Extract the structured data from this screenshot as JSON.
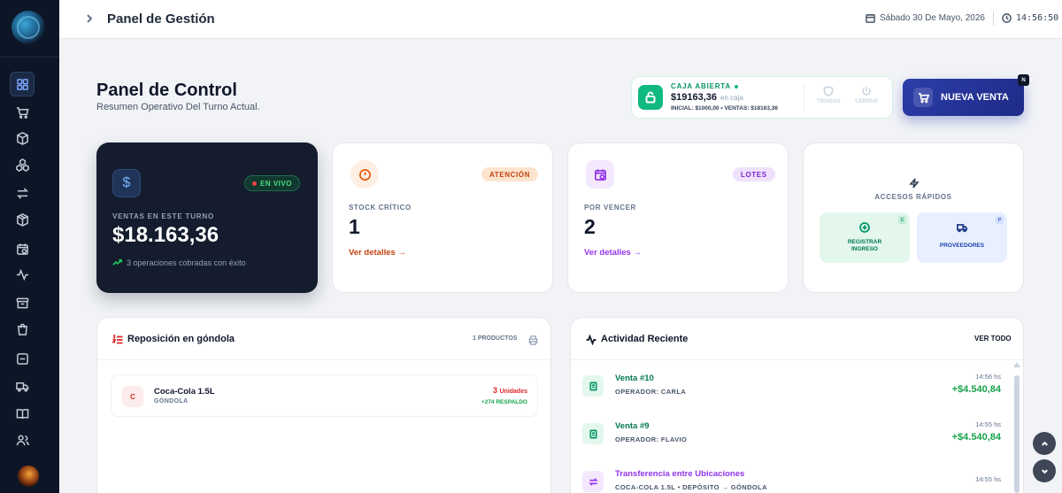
{
  "topbar": {
    "title": "Panel de Gestión",
    "date": "Sábado 30 De Mayo, 2026",
    "time": "14:56:50"
  },
  "header": {
    "title": "Panel de Control",
    "subtitle": "Resumen Operativo Del Turno Actual."
  },
  "caja": {
    "status": "CAJA ABIERTA",
    "amount": "$19163,36",
    "amount_suffix": "en caja",
    "detail": "INICIAL: $1000,00 • VENTAS: $18163,36",
    "action_1": "TIRADAS",
    "action_2": "CERRAR"
  },
  "new_sale": {
    "label": "NUEVA VENTA",
    "shortcut": "N"
  },
  "shift_card": {
    "badge": "EN VIVO",
    "label": "VENTAS EN ESTE TURNO",
    "amount": "$18.163,36",
    "note": "3 operaciones cobradas con éxito"
  },
  "stock_card": {
    "badge": "ATENCIÓN",
    "label": "STOCK CRÍTICO",
    "value": "1",
    "link": "Ver detalles →"
  },
  "expiry_card": {
    "badge": "LOTES",
    "label": "POR VENCER",
    "value": "2",
    "link": "Ver detalles →"
  },
  "quick_access": {
    "title": "ACCESOS RÁPIDOS",
    "register": {
      "line1": "REGISTRAR",
      "line2": "INGRESO",
      "key": "C"
    },
    "providers": {
      "label": "PROVEEDORES",
      "key": "P"
    }
  },
  "restock_panel": {
    "title": "Reposición en góndola",
    "count": "1 PRODUCTOS",
    "item": {
      "letter": "C",
      "name": "Coca-Cola 1.5L",
      "location": "GÓNDOLA",
      "qty": "3",
      "qty_unit": "Unidades",
      "backup": "+274 RESPALDO"
    }
  },
  "activity_panel": {
    "title": "Actividad Reciente",
    "view_all": "VER TODO",
    "items": [
      {
        "title": "Venta #10",
        "sub": "OPERADOR: CARLA",
        "time": "14:56 hs",
        "amount": "+$4.540,84"
      },
      {
        "title": "Venta #9",
        "sub": "OPERADOR: FLAVIO",
        "time": "14:55 hs",
        "amount": "+$4.540,84"
      },
      {
        "title": "Transferencia entre Ubicaciones",
        "sub": "COCA-COLA 1.5L • DEPÓSITO → GÓNDOLA",
        "time": "14:55 hs",
        "amount": ""
      }
    ]
  },
  "colors": {
    "sidebar": "#0d1626",
    "primary": "#2d3eaa",
    "success": "#10b981",
    "danger": "#dc2626",
    "warning": "#ea580c",
    "purple": "#9333ea"
  }
}
